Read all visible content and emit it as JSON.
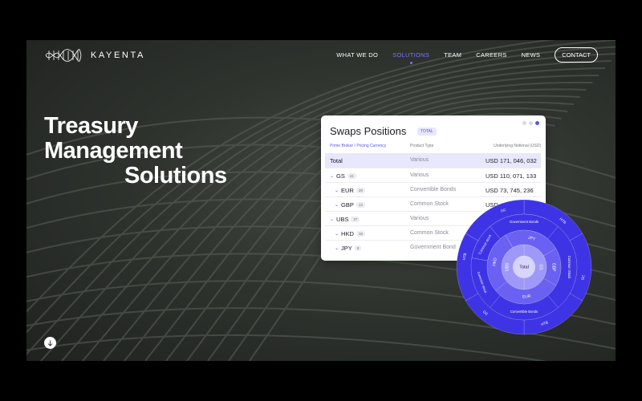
{
  "brand": {
    "name": "KAYENTA",
    "logo_icon": "wave-logo-icon"
  },
  "nav": {
    "items": [
      {
        "label": "WHAT WE DO",
        "active": false
      },
      {
        "label": "SOLUTIONS",
        "active": true
      },
      {
        "label": "TEAM",
        "active": false
      },
      {
        "label": "CAREERS",
        "active": false
      },
      {
        "label": "NEWS",
        "active": false
      }
    ],
    "contact": "CONTACT"
  },
  "hero": {
    "line1": "Treasury",
    "line2": "Management",
    "line3": "Solutions"
  },
  "card": {
    "title": "Swaps Positions",
    "badge": "TOTAL",
    "columns": [
      "Prime Broker / Pricing Currency",
      "Product Type",
      "Underlying Notional (USD)"
    ],
    "rows": [
      {
        "name": "Total",
        "count": "",
        "type": "Various",
        "value": "USD  171, 046, 032"
      },
      {
        "name": "GS",
        "count": "41",
        "type": "Various",
        "value": "USD  110, 071, 133"
      },
      {
        "name": "EUR",
        "count": "28",
        "type": "Convertible Bonds",
        "value": "USD  73, 745, 236"
      },
      {
        "name": "GBP",
        "count": "13",
        "type": "Common Stock",
        "value": "USD"
      },
      {
        "name": "UBS",
        "count": "27",
        "type": "Various",
        "value": "U"
      },
      {
        "name": "HKD",
        "count": "18",
        "type": "Common Stock",
        "value": ""
      },
      {
        "name": "JPY",
        "count": "8",
        "type": "Government Bond",
        "value": ""
      }
    ]
  },
  "sunburst": {
    "center": "Total",
    "ring1": [
      "GS",
      "UBS"
    ],
    "ring2": [
      "JPY",
      "GBP",
      "EUR",
      "HKD"
    ],
    "ring3": [
      "Government Bonds",
      "Common Stock",
      "Convertible Bonds",
      "Common stock",
      "Common stock"
    ],
    "ring4": [
      "HTB",
      "GC",
      "HTB",
      "GC",
      "HTB",
      "GC"
    ],
    "colors": {
      "outer": "#3e34e6",
      "mid": "#6a61f2",
      "inner": "#9e98f8",
      "center": "#d7d4ff"
    }
  },
  "colors": {
    "accent": "#7b73ff",
    "background": "#2f332e"
  }
}
